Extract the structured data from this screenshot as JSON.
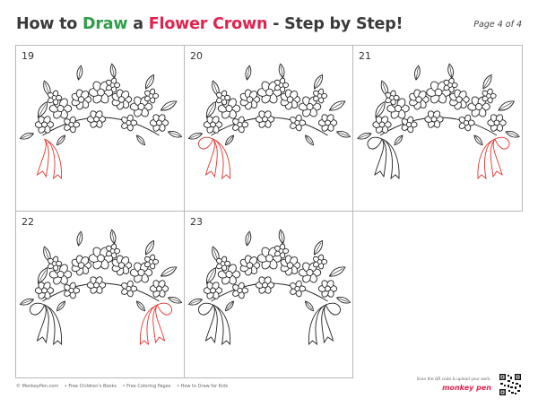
{
  "header": {
    "title_part1": "How to ",
    "title_draw": "Draw",
    "title_part2": " a ",
    "title_subject": "Flower Crown",
    "title_part3": " - Step by Step!",
    "page_label": "Page 4 of 4"
  },
  "steps": [
    {
      "number": "19"
    },
    {
      "number": "20"
    },
    {
      "number": "21"
    },
    {
      "number": "22"
    },
    {
      "number": "23"
    }
  ],
  "footer": {
    "links": [
      "© MonkeyPen.com",
      "• Free Children's Books",
      "• Free Coloring Pages",
      "• How to Draw for Kids"
    ],
    "scan_note": "Scan the QR code & upload your work.",
    "brand": "monkey pen"
  },
  "colors": {
    "accent_green": "#2e9e4a",
    "accent_red": "#e0234e",
    "highlight": "#e0342e"
  }
}
